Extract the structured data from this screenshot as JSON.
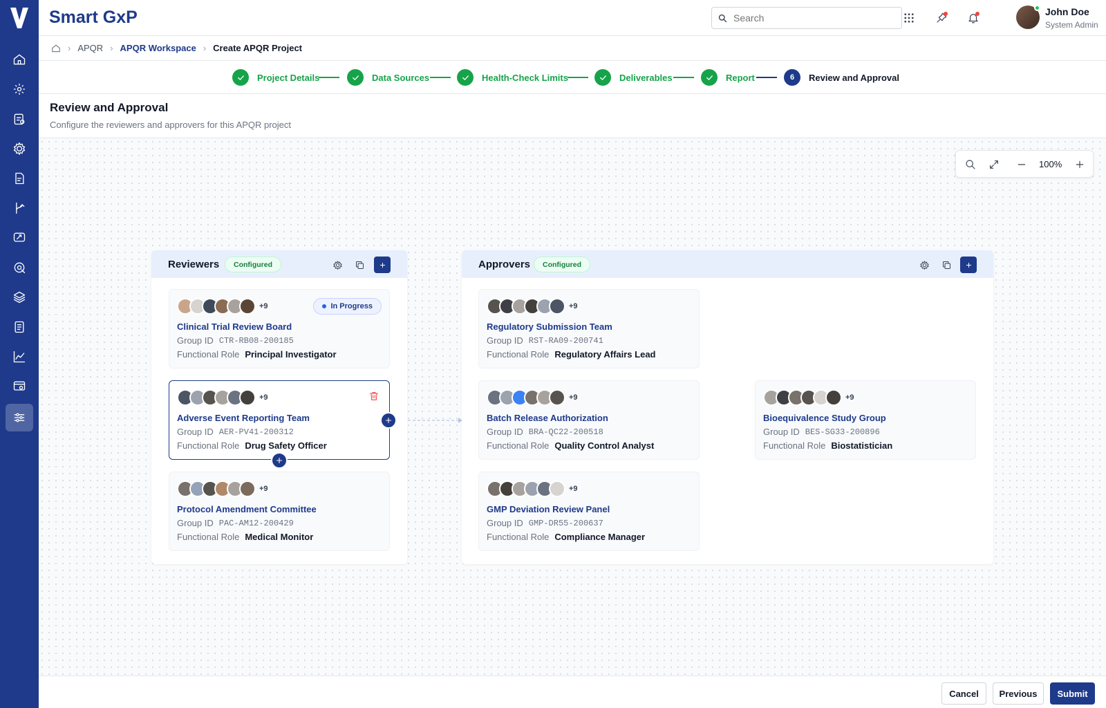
{
  "app": {
    "title": "Smart GxP"
  },
  "search": {
    "placeholder": "Search"
  },
  "user": {
    "name": "John Doe",
    "role": "System Admin"
  },
  "breadcrumb": [
    "APQR",
    "APQR Workspace",
    "Create APQR Project"
  ],
  "steps": [
    {
      "label": "Project Details",
      "state": "done"
    },
    {
      "label": "Data Sources",
      "state": "done"
    },
    {
      "label": "Health-Check Limits",
      "state": "done"
    },
    {
      "label": "Deliverables",
      "state": "done"
    },
    {
      "label": "Report",
      "state": "done"
    },
    {
      "number": "6",
      "label": "Review and Approval",
      "state": "current"
    }
  ],
  "page": {
    "title": "Review and Approval",
    "subtitle": "Configure the reviewers and approvers for this APQR project"
  },
  "zoom": {
    "value": "100%"
  },
  "labels": {
    "group_id": "Group ID",
    "functional_role": "Functional Role"
  },
  "reviewers": {
    "title": "Reviewers",
    "badge": "Configured",
    "cards": [
      {
        "title": "Clinical Trial Review Board",
        "group_id": "CTR-RB08-200185",
        "role": "Principal Investigator",
        "more": "+9",
        "status": "In Progress"
      },
      {
        "title": "Adverse Event Reporting Team",
        "group_id": "AER-PV41-200312",
        "role": "Drug Safety Officer",
        "more": "+9"
      },
      {
        "title": "Protocol Amendment Committee",
        "group_id": "PAC-AM12-200429",
        "role": "Medical Monitor",
        "more": "+9"
      }
    ]
  },
  "approvers": {
    "title": "Approvers",
    "badge": "Configured",
    "cards": [
      {
        "title": "Regulatory Submission Team",
        "group_id": "RST-RA09-200741",
        "role": "Regulatory Affairs Lead",
        "more": "+9"
      },
      {
        "title": "Batch Release Authorization",
        "group_id": "BRA-QC22-200518",
        "role": "Quality Control Analyst",
        "more": "+9"
      },
      {
        "title": "GMP Deviation Review Panel",
        "group_id": "GMP-DR55-200637",
        "role": "Compliance Manager",
        "more": "+9"
      },
      {
        "title": "Bioequivalence Study Group",
        "group_id": "BES-SG33-200896",
        "role": "Biostatistician",
        "more": "+9"
      }
    ]
  },
  "footer": {
    "cancel": "Cancel",
    "previous": "Previous",
    "submit": "Submit"
  },
  "colors": {
    "primary": "#1e3a8a",
    "success": "#16a34a",
    "danger": "#ef4444"
  },
  "nav_icons": [
    "home-icon",
    "settings-icon",
    "clipboard-icon",
    "gear-icon",
    "document-icon",
    "git-branch-icon",
    "message-icon",
    "target-icon",
    "layers-icon",
    "book-icon",
    "line-chart-icon",
    "monitor-icon",
    "sliders-icon"
  ]
}
